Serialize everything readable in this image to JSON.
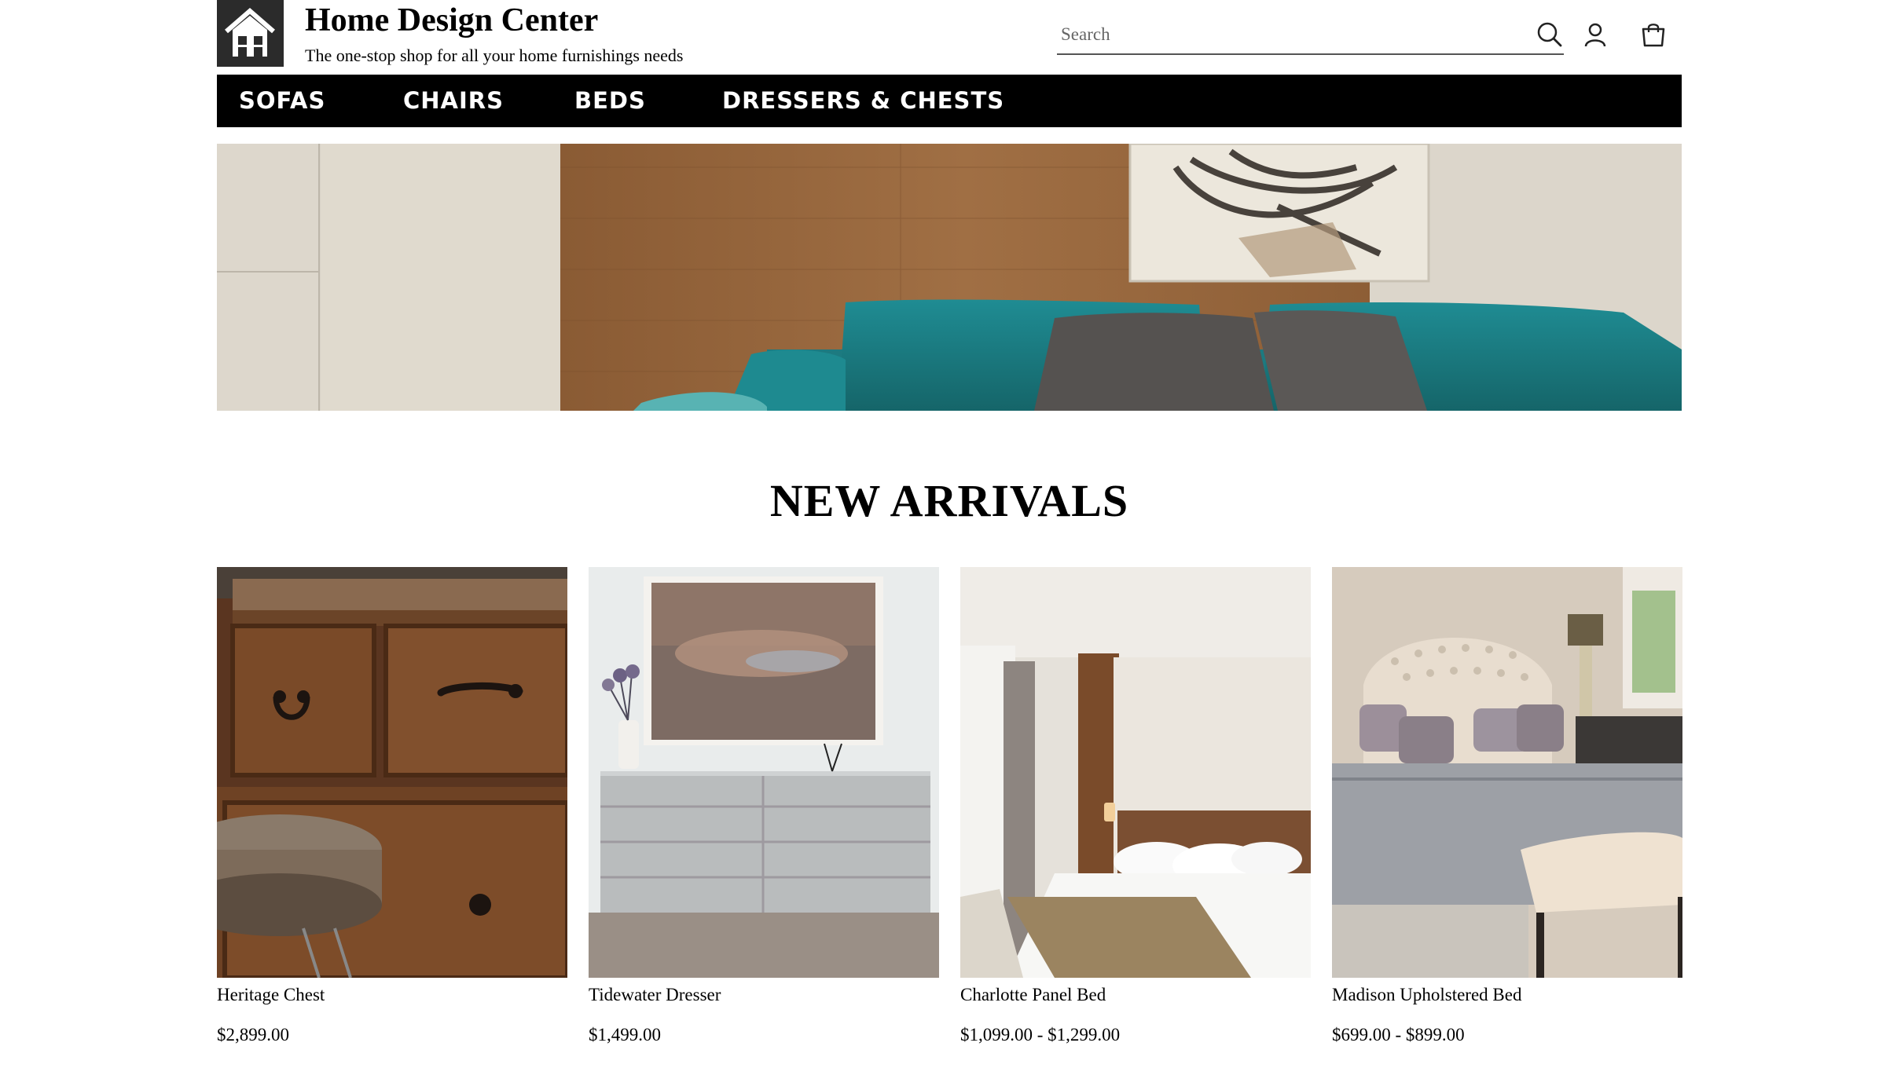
{
  "header": {
    "brand_title": "Home Design Center",
    "tagline": "The one-stop shop for all your home furnishings needs",
    "search_placeholder": "Search"
  },
  "nav": {
    "items": [
      {
        "label": "SOFAS"
      },
      {
        "label": "CHAIRS"
      },
      {
        "label": "BEDS"
      },
      {
        "label": "DRESSERS & CHESTS"
      }
    ]
  },
  "section": {
    "title": "NEW ARRIVALS"
  },
  "products": [
    {
      "name": "Heritage Chest",
      "price": "$2,899.00"
    },
    {
      "name": "Tidewater Dresser",
      "price": "$1,499.00"
    },
    {
      "name": "Charlotte Panel Bed",
      "price": "$1,099.00 - $1,299.00"
    },
    {
      "name": "Madison Upholstered Bed",
      "price": "$699.00 - $899.00"
    }
  ],
  "colors": {
    "nav_bg": "#000000",
    "accent_teal": "#1f7f86",
    "wood": "#8a5a32"
  }
}
